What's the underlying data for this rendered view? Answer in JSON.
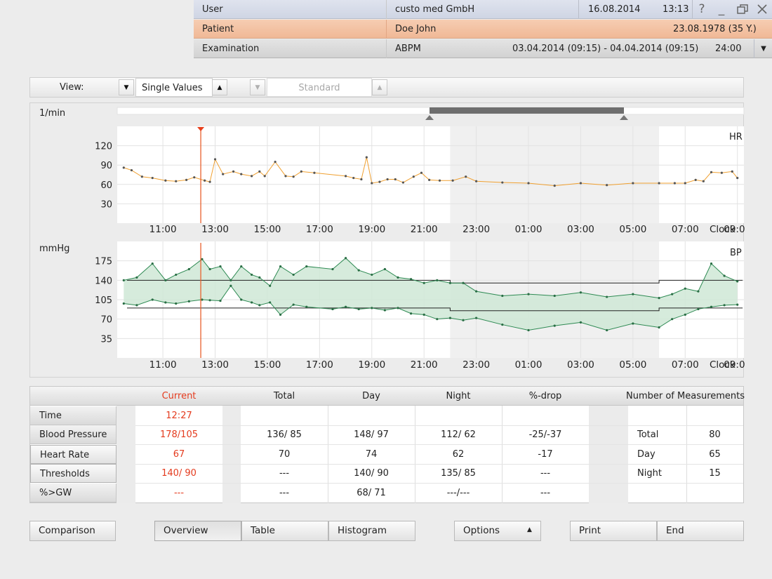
{
  "header": {
    "user": {
      "label": "User",
      "value": "custo med GmbH",
      "date": "16.08.2014",
      "time": "13:13"
    },
    "patient": {
      "label": "Patient",
      "value": "Doe John",
      "birth": "23.08.1978 (35 Y.)"
    },
    "examination": {
      "label": "Examination",
      "value": "ABPM",
      "range": "03.04.2014 (09:15) - 04.04.2014 (09:15)",
      "duration": "24:00"
    },
    "window_icons": [
      "help-icon",
      "minimize-icon",
      "restore-icon",
      "close-icon"
    ]
  },
  "toolbar": {
    "view_label": "View:",
    "view_value": "Single Values",
    "mode_value": "Standard"
  },
  "charts": {
    "hr": {
      "unit": "1/min",
      "name": "HR",
      "yticks": [
        "120",
        "90",
        "60",
        "30"
      ]
    },
    "bp": {
      "unit": "mmHg",
      "name": "BP",
      "yticks": [
        "175",
        "140",
        "105",
        "70",
        "35"
      ]
    },
    "xticks": [
      "11:00",
      "13:00",
      "15:00",
      "17:00",
      "19:00",
      "21:00",
      "23:00",
      "01:00",
      "03:00",
      "05:00",
      "07:00",
      "09:00"
    ],
    "xunit": "Clock"
  },
  "chart_data": {
    "type": "line",
    "x_range": [
      "09:15",
      "09:15 (+1)"
    ],
    "night_period": [
      "22:00",
      "06:00"
    ],
    "current_marker": "12:27",
    "heart_rate": {
      "ylim": [
        0,
        150
      ],
      "x": [
        9.5,
        9.8,
        10.2,
        10.6,
        11.1,
        11.5,
        11.9,
        12.2,
        12.6,
        12.8,
        13.0,
        13.3,
        13.7,
        14.0,
        14.4,
        14.7,
        14.9,
        15.3,
        15.7,
        16.0,
        16.3,
        16.8,
        18.0,
        18.3,
        18.6,
        18.8,
        19.0,
        19.3,
        19.6,
        19.9,
        20.2,
        20.6,
        20.9,
        21.2,
        21.6,
        22.1,
        22.6,
        23.0,
        24.0,
        25.0,
        26.0,
        27.0,
        28.0,
        29.0,
        30.0,
        30.6,
        31.0,
        31.4,
        31.7,
        32.0,
        32.4,
        32.8,
        33.0
      ],
      "y": [
        86,
        82,
        72,
        70,
        66,
        65,
        67,
        71,
        66,
        64,
        99,
        76,
        80,
        76,
        73,
        80,
        73,
        95,
        73,
        72,
        80,
        78,
        73,
        70,
        68,
        102,
        62,
        64,
        68,
        68,
        63,
        72,
        78,
        67,
        66,
        66,
        72,
        65,
        63,
        62,
        58,
        62,
        59,
        62,
        62,
        62,
        62,
        67,
        65,
        79,
        78,
        80,
        70
      ]
    },
    "blood_pressure": {
      "ylim": [
        0,
        210
      ],
      "threshold_day": [
        140,
        90
      ],
      "threshold_night": [
        135,
        85
      ],
      "x": [
        9.5,
        10.0,
        10.6,
        11.1,
        11.5,
        12.0,
        12.5,
        12.8,
        13.2,
        13.6,
        14.0,
        14.4,
        14.7,
        15.1,
        15.5,
        16.0,
        16.5,
        17.5,
        18.0,
        18.5,
        19.0,
        19.5,
        20.0,
        20.5,
        21.0,
        21.5,
        22.0,
        22.5,
        23.0,
        24.0,
        25.0,
        26.0,
        27.0,
        28.0,
        29.0,
        30.0,
        30.5,
        31.0,
        31.5,
        32.0,
        32.5,
        33.0
      ],
      "sys": [
        140,
        145,
        170,
        140,
        150,
        160,
        178,
        160,
        165,
        140,
        165,
        150,
        145,
        130,
        165,
        150,
        165,
        160,
        180,
        158,
        150,
        160,
        145,
        142,
        135,
        140,
        135,
        135,
        120,
        112,
        115,
        112,
        118,
        110,
        115,
        108,
        115,
        125,
        120,
        170,
        148,
        138
      ],
      "dia": [
        98,
        95,
        105,
        100,
        98,
        102,
        105,
        104,
        103,
        130,
        105,
        100,
        95,
        100,
        78,
        96,
        92,
        88,
        92,
        88,
        90,
        86,
        90,
        80,
        78,
        70,
        72,
        68,
        72,
        60,
        50,
        58,
        64,
        50,
        62,
        55,
        70,
        78,
        88,
        92,
        95,
        96
      ]
    }
  },
  "stats": {
    "columns": {
      "current": "Current",
      "total": "Total",
      "day": "Day",
      "night": "Night",
      "drop": "%-drop",
      "count": "Number of Measurements"
    },
    "rows": {
      "time": {
        "label": "Time",
        "current": "12:27"
      },
      "bp": {
        "label": "Blood Pressure",
        "current": "178/105",
        "total": "136/ 85",
        "day": "148/ 97",
        "night": "112/ 62",
        "drop": "-25/-37",
        "count_label": "Total",
        "count": "80"
      },
      "hr": {
        "label": "Heart Rate",
        "current": "67",
        "total": "70",
        "day": "74",
        "night": "62",
        "drop": "-17",
        "count_label": "Day",
        "count": "65"
      },
      "thr": {
        "label": "Thresholds",
        "current": "140/ 90",
        "total": "---",
        "day": "140/ 90",
        "night": "135/ 85",
        "drop": "---",
        "count_label": "Night",
        "count": "15"
      },
      "gw": {
        "label": "%>GW",
        "current": "---",
        "total": "---",
        "day": "68/ 71",
        "night": "---/---",
        "drop": "---"
      }
    }
  },
  "buttons": {
    "comparison": "Comparison",
    "overview": "Overview",
    "table": "Table",
    "histogram": "Histogram",
    "options": "Options",
    "print": "Print",
    "end": "End"
  }
}
